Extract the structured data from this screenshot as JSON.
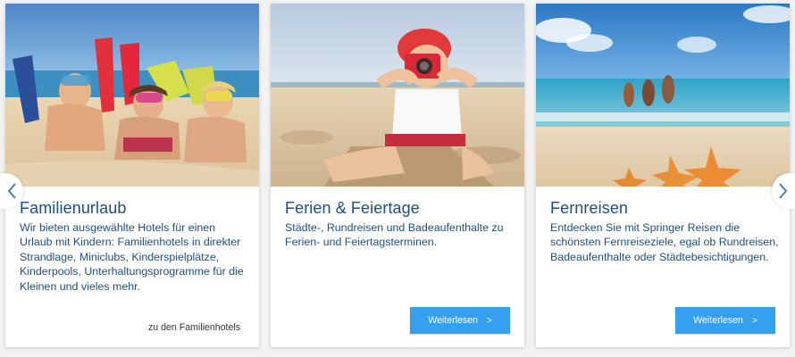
{
  "cards": [
    {
      "title": "Familienurlaub",
      "text": "Wir bieten ausgewählte Hotels für einen Urlaub mit Kindern: Familienhotels in direkter Strandlage, Miniclubs, Kinderspielplätze, Kinderpools, Unterhaltungsprogramme für die Kleinen und vieles mehr.",
      "link_label": "zu den Familienhotels",
      "image": "kids-with-flippers-on-beach"
    },
    {
      "title": "Ferien & Feiertage",
      "text": "Städte-, Rundreisen und Badeaufenthalte zu Ferien- und Feiertagsterminen.",
      "button_label": "Weiterlesen",
      "button_icon": "chevron-right-icon",
      "image": "child-with-camera-on-beach"
    },
    {
      "title": "Fernreisen",
      "text": "Entdecken Sie mit Springer Reisen die schönsten Fernreiseziele, egal ob Rundreisen, Badeaufenthalte oder Städtebesichtigungen.",
      "button_label": "Weiterlesen",
      "button_icon": "chevron-right-icon",
      "image": "starfish-beach-people-in-sea"
    }
  ],
  "navigation": {
    "prev_icon": "chevron-left-icon",
    "next_icon": "chevron-right-icon"
  },
  "colors": {
    "title": "#1c4e80",
    "button": "#36a0f0",
    "arrow": "#4a7fb5"
  }
}
